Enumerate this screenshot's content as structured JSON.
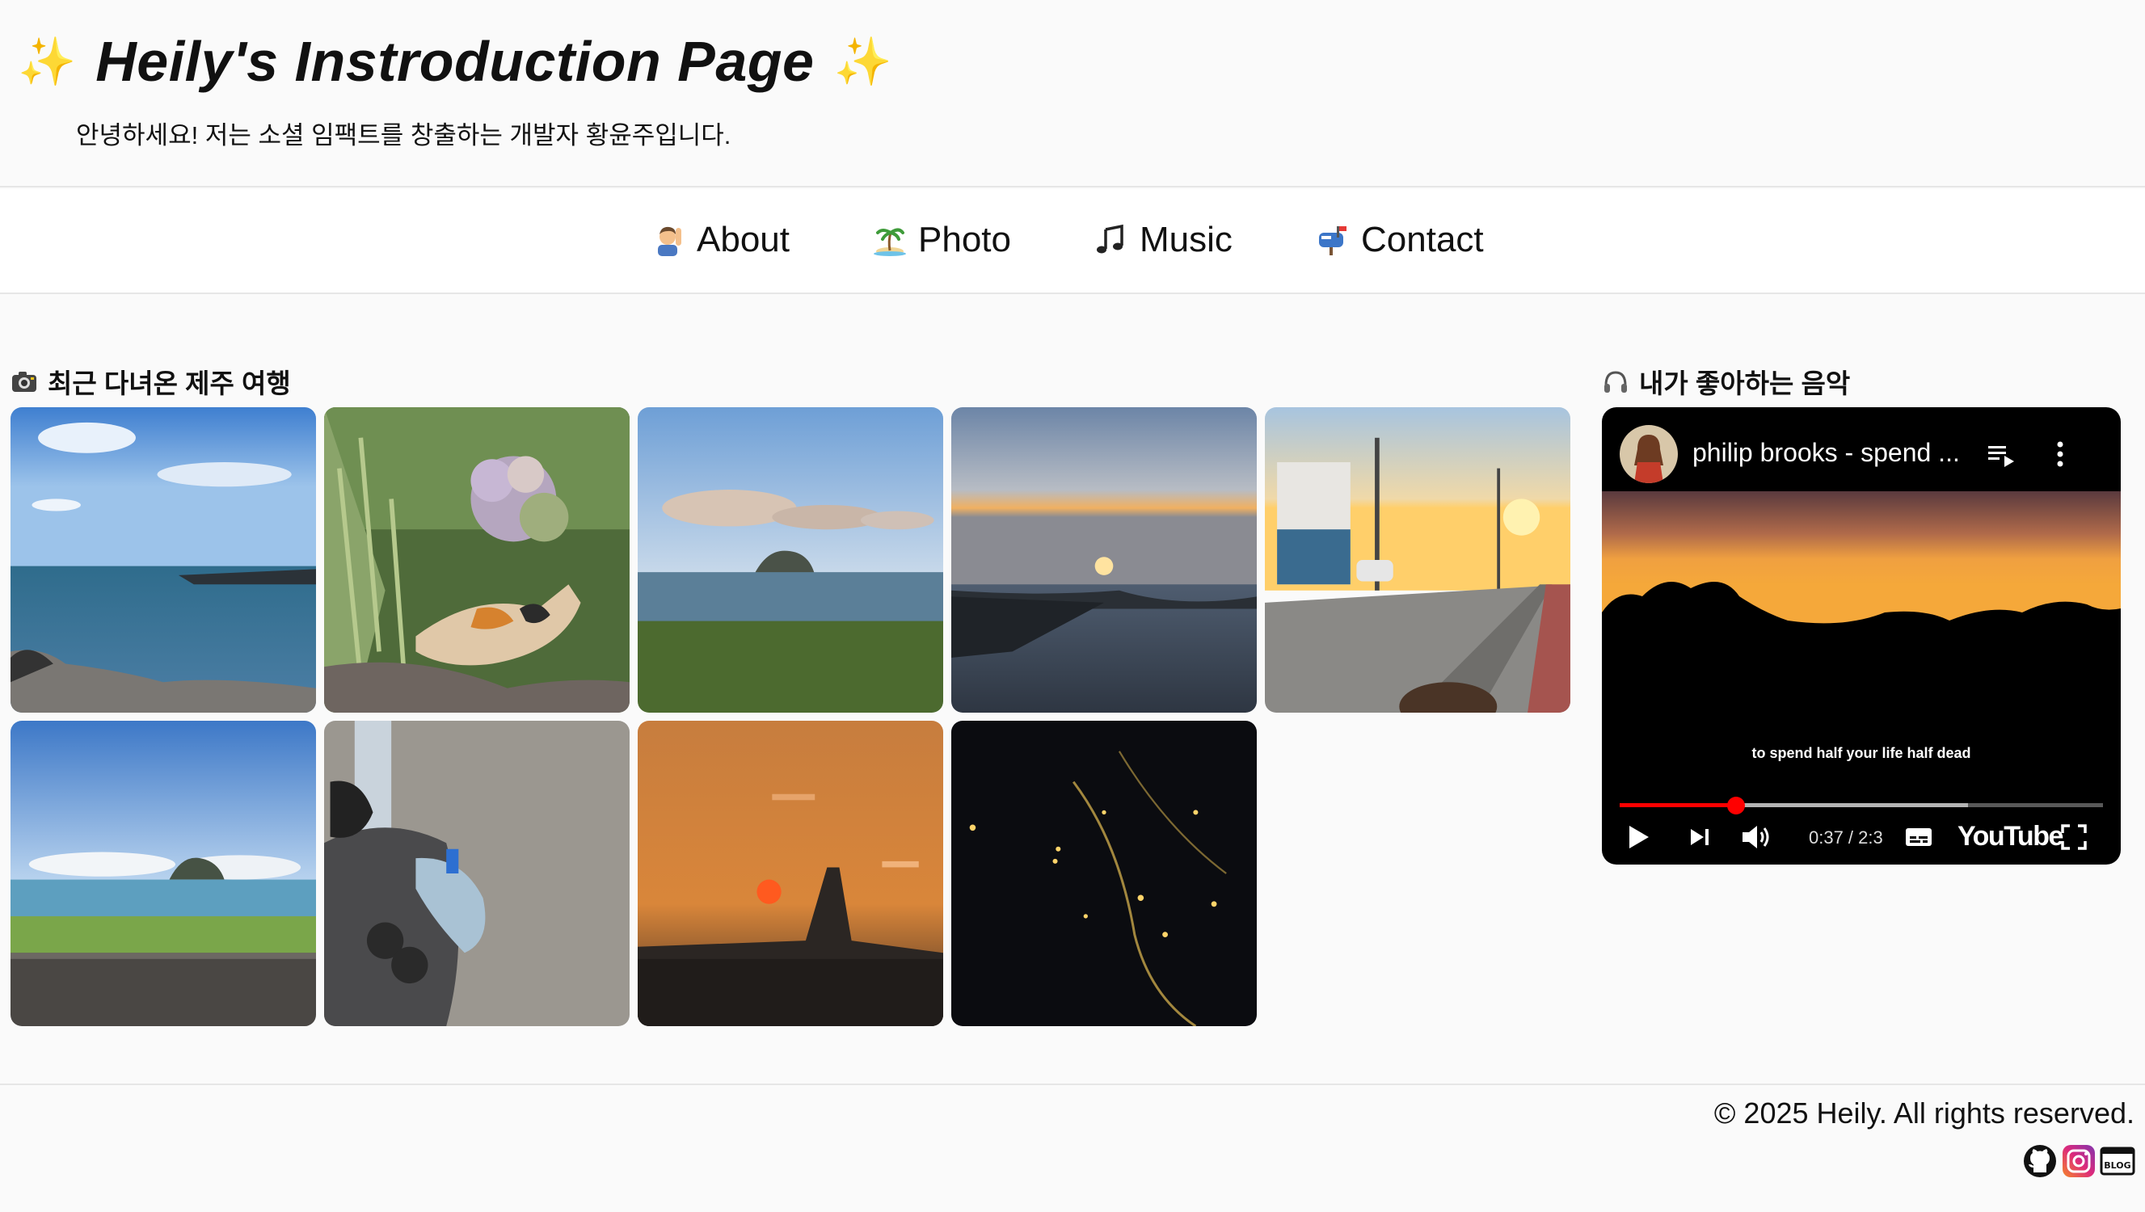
{
  "header": {
    "title": "Heily's Instroduction Page",
    "sparkle_left": "✨",
    "sparkle_right": "✨",
    "subtitle": "안녕하세요! 저는 소셜 임팩트를 창출하는 개발자 황윤주입니다."
  },
  "nav": {
    "items": [
      {
        "label": "About",
        "icon": "person-raising-hand-icon"
      },
      {
        "label": "Photo",
        "icon": "island-icon"
      },
      {
        "label": "Music",
        "icon": "music-note-icon"
      },
      {
        "label": "Contact",
        "icon": "mailbox-icon"
      }
    ]
  },
  "gallery": {
    "title": "최근 다녀온 제주 여행",
    "icon": "camera-icon",
    "photos": [
      {
        "scene": "sea-rocks"
      },
      {
        "scene": "cat-hydrangea"
      },
      {
        "scene": "island-sea"
      },
      {
        "scene": "sunset-water"
      },
      {
        "scene": "street-sunset"
      },
      {
        "scene": "beach-island"
      },
      {
        "scene": "pavement-feet"
      },
      {
        "scene": "airport-sunset"
      },
      {
        "scene": "night-city-lights"
      }
    ]
  },
  "music": {
    "title": "내가 좋아하는 음악",
    "icon": "headphones-icon",
    "video": {
      "title": "philip brooks - spend ...",
      "caption": "to spend half your life half dead",
      "time": "0:37 / 2:3",
      "progress": 0.24,
      "loaded": 0.72,
      "logo": "YouTube"
    }
  },
  "footer": {
    "copyright": "© 2025 Heily. All rights reserved.",
    "links": [
      {
        "icon": "github-icon"
      },
      {
        "icon": "instagram-icon"
      },
      {
        "icon": "blog-icon",
        "label": "BLOG"
      }
    ]
  },
  "colors": {
    "background": "#fafafa",
    "nav_background": "#ffffff",
    "divider": "#e6e6e6",
    "youtube_red": "#ff0000",
    "instagram_gradient_start": "#f58529",
    "instagram_gradient_end": "#8134af"
  }
}
